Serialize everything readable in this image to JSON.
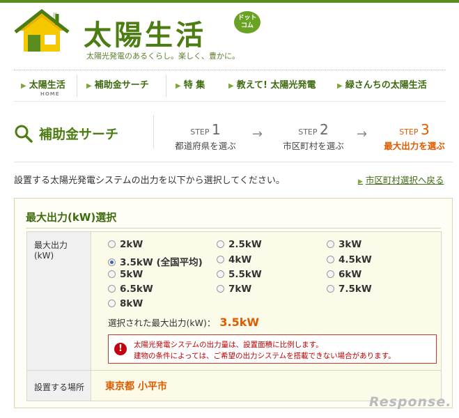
{
  "brand": {
    "title": "太陽生活",
    "badge": "ドット\nコム",
    "tagline": "太陽光発電のあるくらし。楽しく、豊かに。"
  },
  "nav": {
    "items": [
      {
        "label": "太陽生活",
        "sub": "HOME"
      },
      {
        "label": "補助金サーチ"
      },
      {
        "label": "特 集"
      },
      {
        "label": "教えて! 太陽光発電"
      },
      {
        "label": "緑さんちの太陽生活"
      }
    ]
  },
  "search": {
    "title": "補助金サーチ",
    "steps": [
      {
        "step": "STEP",
        "num": "1",
        "label": "都道府県を選ぶ"
      },
      {
        "step": "STEP",
        "num": "2",
        "label": "市区町村を選ぶ"
      },
      {
        "step": "STEP",
        "num": "3",
        "label": "最大出力を選ぶ"
      }
    ],
    "arrow": "→"
  },
  "instruction": "設置する太陽光発電システムの出力を以下から選択してください。",
  "back_link": "市区町村選択へ戻る",
  "panel": {
    "title": "最大出力(kW)選択",
    "row1_label": "最大出力\n(kW)",
    "options": [
      "2kW",
      "2.5kW",
      "3kW",
      "3.5kW (全国平均)",
      "4kW",
      "4.5kW",
      "5kW",
      "5.5kW",
      "6kW",
      "6.5kW",
      "7kW",
      "7.5kW",
      "8kW"
    ],
    "selected_index": 3,
    "selected_label": "選択された最大出力(kW)：",
    "selected_value": "3.5kW",
    "warning_icon": "!",
    "warning_lines": [
      "太陽光発電システムの出力量は、設置面積に比例します。",
      "建物の条件によっては、ご希望の出力システムを搭載できない場合があります。"
    ],
    "row2_label": "設置する場所",
    "place": "東京都 小平市"
  },
  "watermark": "Response.",
  "colors": {
    "brand_green": "#4b7d12",
    "accent_orange": "#e05a00",
    "warning_red": "#c00000"
  }
}
